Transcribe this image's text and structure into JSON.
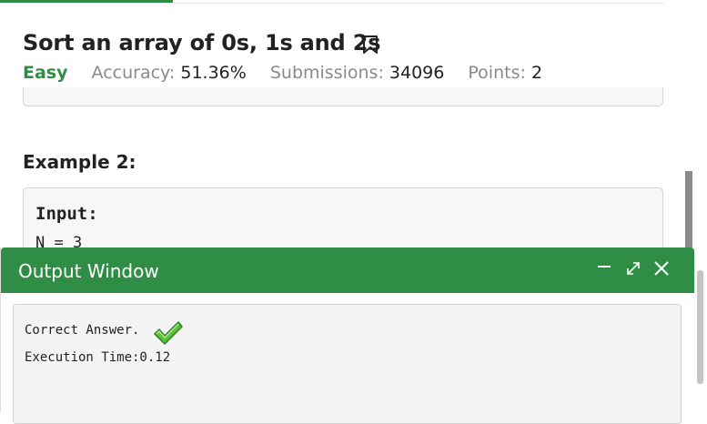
{
  "problem": {
    "title": "Sort an array of 0s, 1s and 2s",
    "difficulty": "Easy",
    "accuracy_label": "Accuracy:",
    "accuracy_value": "51.36%",
    "submissions_label": "Submissions:",
    "submissions_value": "34096",
    "points_label": "Points:",
    "points_value": "2"
  },
  "example": {
    "heading": "Example 2:",
    "input_label": "Input:",
    "input_line": "N = 3"
  },
  "output_window": {
    "title": "Output Window",
    "result": "Correct Answer.",
    "execution": "Execution Time:0.12"
  },
  "colors": {
    "accent": "#2f8d46"
  },
  "icons": {
    "bookmark": "bookmark-icon",
    "minimize": "minimize-icon",
    "expand": "expand-icon",
    "close": "close-icon",
    "check": "check-icon"
  }
}
